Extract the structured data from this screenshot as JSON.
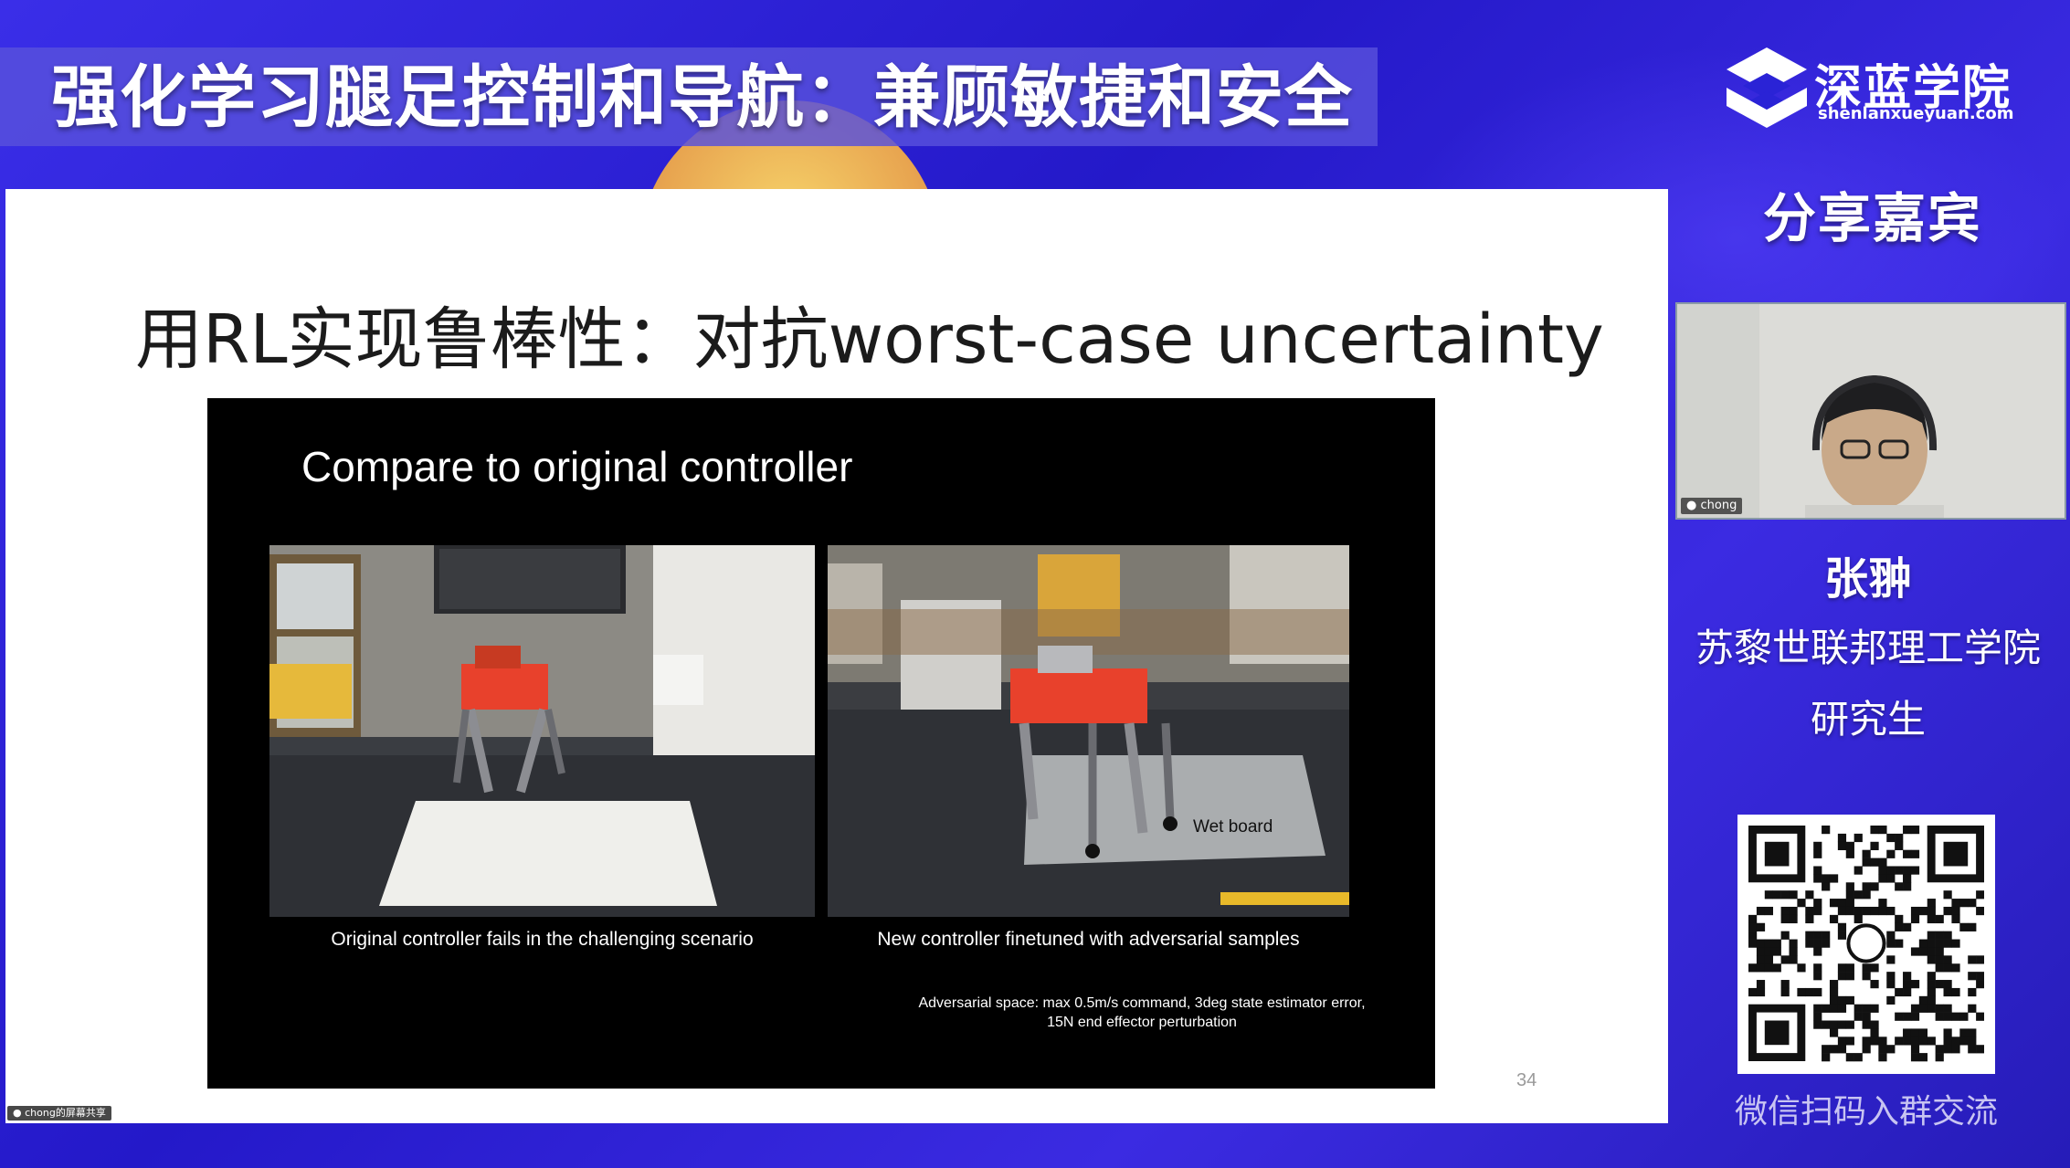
{
  "header": {
    "title": "强化学习腿足控制和导航：兼顾敏捷和安全"
  },
  "brand": {
    "name_cn": "深蓝学院",
    "url_text": "shenlanxueyuan.com"
  },
  "sidebar": {
    "guest_heading": "分享嘉宾",
    "speaker_name": "张翀",
    "speaker_affiliation": "苏黎世联邦理工学院",
    "speaker_role": "研究生",
    "qr_caption": "微信扫码入群交流",
    "webcam_label": "chong"
  },
  "slide": {
    "title": "用RL实现鲁棒性：对抗worst-case uncertainty",
    "video_heading": "Compare to original controller",
    "left_caption": "Original controller fails in the challenging scenario",
    "right_caption": "New controller finetuned with adversarial samples",
    "wet_board_label": "Wet board",
    "note_line1": "Adversarial space: max 0.5m/s command, 3deg state estimator error,",
    "note_line2": "15N end effector perturbation",
    "page_number": "34"
  },
  "screen_share_label": "chong的屏幕共享",
  "colors": {
    "background": "#2a23d6",
    "title_band": "#5850dc",
    "slide_bg": "#ffffff",
    "video_bg": "#000000",
    "robot_orange": "#e8412c"
  }
}
